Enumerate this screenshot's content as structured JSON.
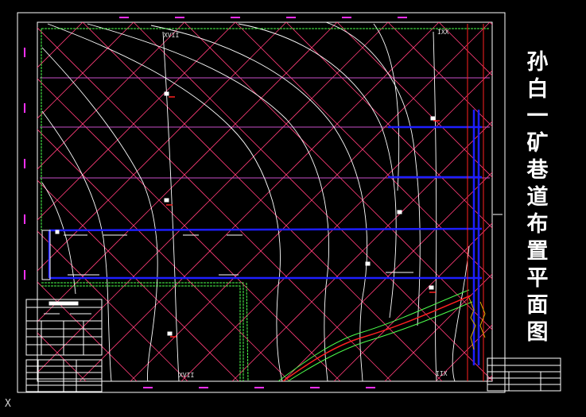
{
  "drawing": {
    "title_chars": [
      "孙",
      "白",
      "一",
      "矿",
      "巷",
      "道",
      "布",
      "置",
      "平",
      "面",
      "图"
    ],
    "grid_labels": {
      "top_left": "XVII",
      "top_right": "IXX",
      "bottom_left": "XVII",
      "bottom_right": "IIX"
    },
    "ucs_marker": "X"
  },
  "colors": {
    "background": "#000000",
    "border": "#ffffff",
    "grid_diagonal": "#ff3c78",
    "grid_horizontal": "#c84ec8",
    "roadway_blue": "#1e1eff",
    "contour": "#ffffff",
    "boundary_green": "#4cff4c",
    "magenta_tick": "#ff30ff",
    "red_line": "#ff2020"
  }
}
